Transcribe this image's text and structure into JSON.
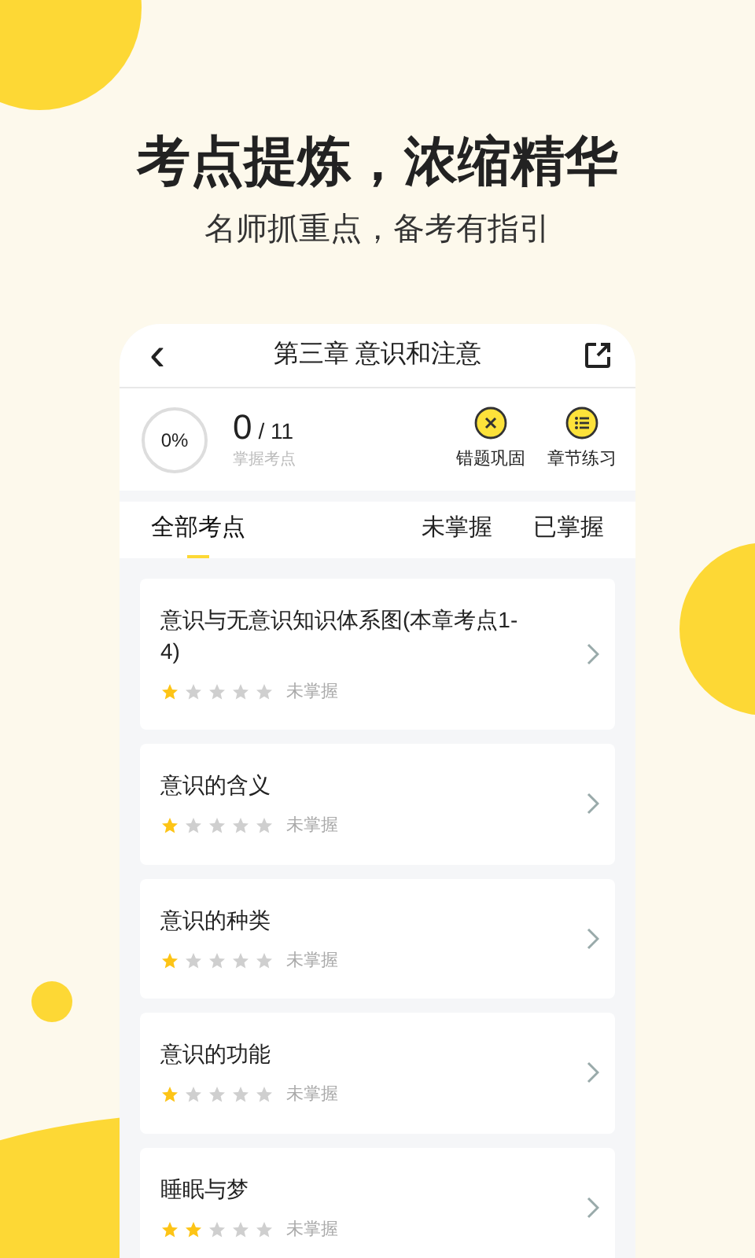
{
  "headline": "考点提炼，浓缩精华",
  "subtitle": "名师抓重点，备考有指引",
  "header": {
    "back": "‹",
    "title": "第三章 意识和注意"
  },
  "stats": {
    "percent": "0%",
    "mastered": "0",
    "total": "/ 11",
    "caption": "掌握考点"
  },
  "actions": [
    {
      "kind": "wrong",
      "label": "错题巩固"
    },
    {
      "kind": "practice",
      "label": "章节练习"
    }
  ],
  "tabs": [
    {
      "label": "全部考点",
      "selected": true
    },
    {
      "label": "未掌握",
      "selected": false
    },
    {
      "label": "已掌握",
      "selected": false
    }
  ],
  "topics": [
    {
      "title": "意识与无意识知识体系图(本章考点1-4)",
      "stars": 1,
      "status": "未掌握"
    },
    {
      "title": "意识的含义",
      "stars": 1,
      "status": "未掌握"
    },
    {
      "title": "意识的种类",
      "stars": 1,
      "status": "未掌握"
    },
    {
      "title": "意识的功能",
      "stars": 1,
      "status": "未掌握"
    },
    {
      "title": "睡眠与梦",
      "stars": 2,
      "status": "未掌握"
    }
  ]
}
